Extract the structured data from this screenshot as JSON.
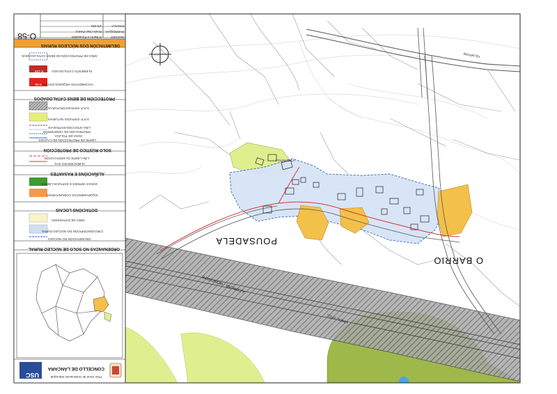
{
  "map": {
    "places": {
      "pousadela": "POUSADELA",
      "o_barrio": "O BARRIO",
      "road_label": "A CORUÑA - MONFORTE",
      "rail_label": "LÍNEA - FFCC"
    },
    "colors": {
      "nucleus": "#d6e4f7",
      "expansion": "#f3c04a",
      "green": "#dfee8e",
      "hatch_band": "#8a8a8a",
      "olive": "#9fb84a"
    }
  },
  "legend": {
    "title": "DELIMITACIÓN DOS NÚCLEOS RURAIS",
    "sections": {
      "ordenanzas": "ORDENANZAS NO SOLO DE NÚCLEO RURAL",
      "dotacions": "DOTACIÓNS LOCAIS",
      "alinacions": "ALIÑACIÓNS E RASANTES",
      "solo_rustico": "SOLO RÚSTICO DE PROTECCIÓN",
      "proteccion": "PROTECCIÓN DE BENS CATALOGADOS"
    },
    "items": {
      "delimitacion": "DELIMITACIÓN DO NÚCLEO",
      "circunscripcion": "CIRCUNSCRIPCIÓN DO NÚCLEO RURAL",
      "area_expansion": "ÁREA DE EXPANSIÓN",
      "equipamentos": "EQUIPAMENTOS COMUNITARIOS",
      "zonas_verdes": "ZONAS VERDES E ESPAZOS LIBRES",
      "linea_limite": "LIÑA LÍMITE DA EDIFICACIÓN",
      "alinacion_vial": "ALIÑACIÓN DO VIAL",
      "limite_proteccion": "LÍMITE DE PROTECCIÓN DE CAUCES",
      "zona_policia": "ZONA DE POLICÍA",
      "proteccion_cemiterios": "PROTECCIÓN DE CEMITERIOS",
      "linea_afeccion": "LIÑA AFECCIÓN ESTRADAS",
      "srp_espazos": "S.R.P. ESPAZOS NATURAIS",
      "srp_infra": "S.R.P. INFRAESTRUTURAS",
      "xacementos": "XACEMENTOS ARQUEOLÓXICOS",
      "elemento_catalogado": "ELEMENTO CATALOGADO",
      "area_proteccion": "ÁREA DE PROTECCIÓN DE BENS CATALOGADOS"
    },
    "codes": {
      "xacementos_code": "X-06",
      "elemento_code": "E-148"
    },
    "colors": {
      "title_bar": "#f0a030",
      "circunscripcion": "#cfe0f5",
      "expansion": "#fbf3c8",
      "equipamentos": "#f29a4a",
      "zonas_verdes": "#3e9a32",
      "srp_espazos": "#e4ef7a",
      "xacementos": "#e8201e",
      "elemento": "#c22a26"
    }
  },
  "title_block": {
    "concello": "CONCELLO DE LÁNCARA",
    "plan": "Plan Xeral de Ordenación Municipal",
    "usc": "USC",
    "sheet_code": "O-58",
    "escala_label": "ESCALA",
    "escala_value": "1/2.000",
    "parroquia_label": "PARROQUIA",
    "parroquia_value": "Ronfe (San Pedro)",
    "nucleo_label": "NÚCLEO",
    "nucleo_value": "O Barrio e Pousadela"
  }
}
